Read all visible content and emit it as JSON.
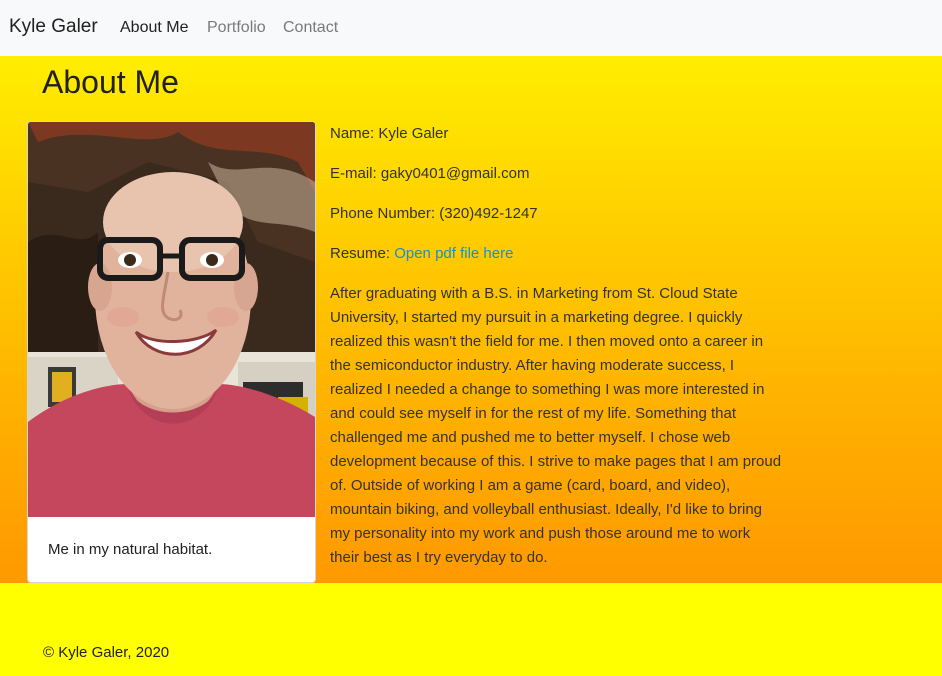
{
  "navbar": {
    "brand": "Kyle Galer",
    "links": [
      {
        "label": "About Me",
        "active": true
      },
      {
        "label": "Portfolio",
        "active": false
      },
      {
        "label": "Contact",
        "active": false
      }
    ]
  },
  "main": {
    "title": "About Me",
    "card": {
      "caption": "Me in my natural habitat."
    },
    "info": {
      "name_label": "Name:",
      "name_value": "Kyle Galer",
      "email_label": "E-mail:",
      "email_value": "gaky0401@gmail.com",
      "phone_label": "Phone Number:",
      "phone_value": "(320)492-1247",
      "resume_label": "Resume:",
      "resume_link": "Open pdf file here",
      "bio": "After graduating with a B.S. in Marketing from St. Cloud State University, I started my pursuit in a marketing degree. I quickly realized this wasn't the field for me. I then moved onto a career in the semiconductor industry. After having moderate success, I realized I needed a change to something I was more interested in and could see myself in for the rest of my life. Something that challenged me and pushed me to better myself. I chose web development because of this. I strive to make pages that I am proud of. Outside of working I am a game (card, board, and video), mountain biking, and volleyball enthusiast. Ideally, I'd like to bring my personality into my work and push those around me to work their best as I try everyday to do."
    }
  },
  "footer": {
    "text": "© Kyle Galer, 2020"
  },
  "colors": {
    "link": "#1a8fc4",
    "navbar_bg": "#f8f9fa",
    "page_bg": "#ffff00",
    "gradient_top": "#ffee00",
    "gradient_bottom": "#ff9900"
  }
}
